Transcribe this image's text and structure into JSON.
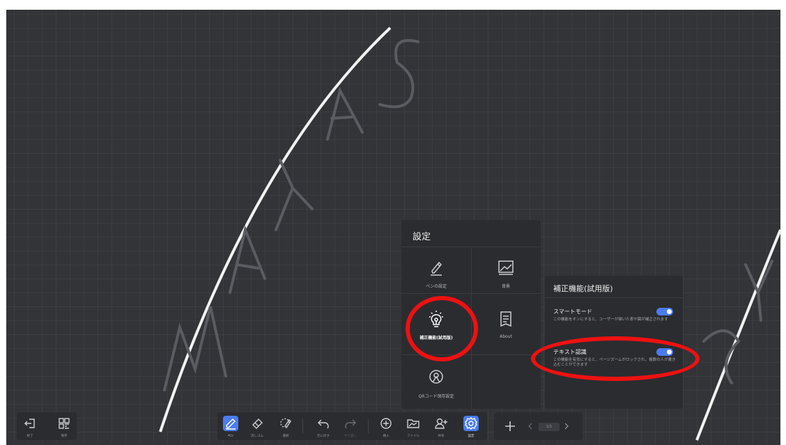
{
  "watermark": {
    "text": "MAYA SYS"
  },
  "settings_panel": {
    "title": "設定",
    "items": [
      {
        "label": "ペンの設定",
        "icon": "pen-settings-icon"
      },
      {
        "label": "背景",
        "icon": "background-image-icon"
      },
      {
        "label": "補正機能(試用版)",
        "icon": "lightbulb-icon"
      },
      {
        "label": "About",
        "icon": "about-document-icon"
      },
      {
        "label": "QRコード保存設定",
        "icon": "qr-save-icon"
      }
    ]
  },
  "assist_panel": {
    "title": "補正機能(試用版)",
    "options": [
      {
        "name": "スマートモード",
        "description": "この機能をオンにすると、ユーザーが描いた表や図が補正されます",
        "enabled": true
      },
      {
        "name": "テキスト認識",
        "description": "この機能を有効にすると、ページズームがロックされ、複数の人が書き込むことができます",
        "enabled": true
      }
    ]
  },
  "toolbar_left": [
    {
      "label": "終了",
      "icon": "exit-icon"
    },
    {
      "label": "保存",
      "icon": "qr-code-icon"
    }
  ],
  "toolbar_main": [
    {
      "label": "ペン",
      "icon": "pen-icon",
      "selected": true
    },
    {
      "label": "消しゴム",
      "icon": "eraser-icon"
    },
    {
      "label": "選択",
      "icon": "lasso-select-icon"
    },
    {
      "label": "元に戻す",
      "icon": "undo-icon"
    },
    {
      "label": "やり直し",
      "icon": "redo-icon"
    },
    {
      "label": "挿入",
      "icon": "insert-plus-icon"
    },
    {
      "label": "ファイル",
      "icon": "file-folder-icon"
    },
    {
      "label": "共有",
      "icon": "share-user-icon"
    },
    {
      "label": "設定",
      "icon": "settings-gear-icon",
      "selected": true
    }
  ],
  "page_nav": {
    "add_icon": "add-page-icon",
    "indicator": "1/1"
  },
  "colors": {
    "accent": "#4a7cf0",
    "annotation": "#ee1111",
    "background": "#323438",
    "panel": "#2b2c30"
  }
}
